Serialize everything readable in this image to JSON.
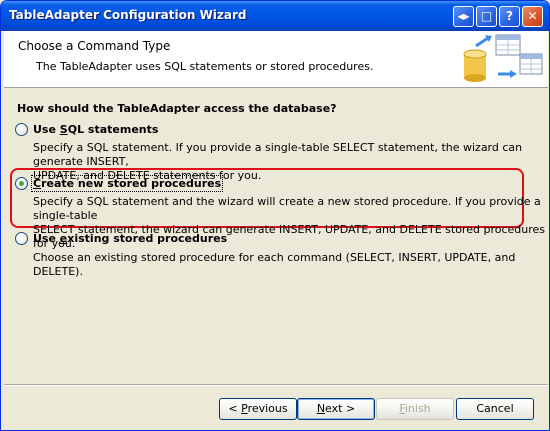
{
  "window": {
    "title": "TableAdapter Configuration Wizard"
  },
  "title_buttons": {
    "extra": "◂▸",
    "maximize": "□",
    "help": "?",
    "close": "✕"
  },
  "header": {
    "title": "Choose a Command Type",
    "subtitle": "The TableAdapter uses SQL statements or stored procedures."
  },
  "question": "How should the TableAdapter access the database?",
  "options": [
    {
      "label_parts": [
        "Use ",
        "S",
        "QL statements"
      ],
      "description_lines": [
        "Specify a SQL statement. If you provide a single-table SELECT statement, the wizard can generate INSERT,",
        "UPDATE, and DELETE statements for you."
      ],
      "selected": false
    },
    {
      "label_parts": [
        "",
        "C",
        "reate new stored procedures"
      ],
      "description_lines": [
        "Specify a SQL statement and the wizard will create a new stored procedure. If you provide a single-table",
        "SELECT statement, the wizard can generate INSERT, UPDATE, and DELETE stored procedures for you."
      ],
      "selected": true
    },
    {
      "label_parts": [
        "Use ",
        "e",
        "xisting stored procedures"
      ],
      "description_lines": [
        "Choose an existing stored procedure for each command (SELECT, INSERT, UPDATE, and DELETE)."
      ],
      "selected": false
    }
  ],
  "buttons": {
    "previous": {
      "pre": "< ",
      "key": "P",
      "post": "revious"
    },
    "next": {
      "pre": "",
      "key": "N",
      "post": "ext >"
    },
    "finish": {
      "pre": "",
      "key": "F",
      "post": "inish"
    },
    "cancel": "Cancel"
  },
  "colors": {
    "titlebar": "#0055e5",
    "highlight_border": "#e0101a",
    "radio_dot": "#3dae3d"
  }
}
